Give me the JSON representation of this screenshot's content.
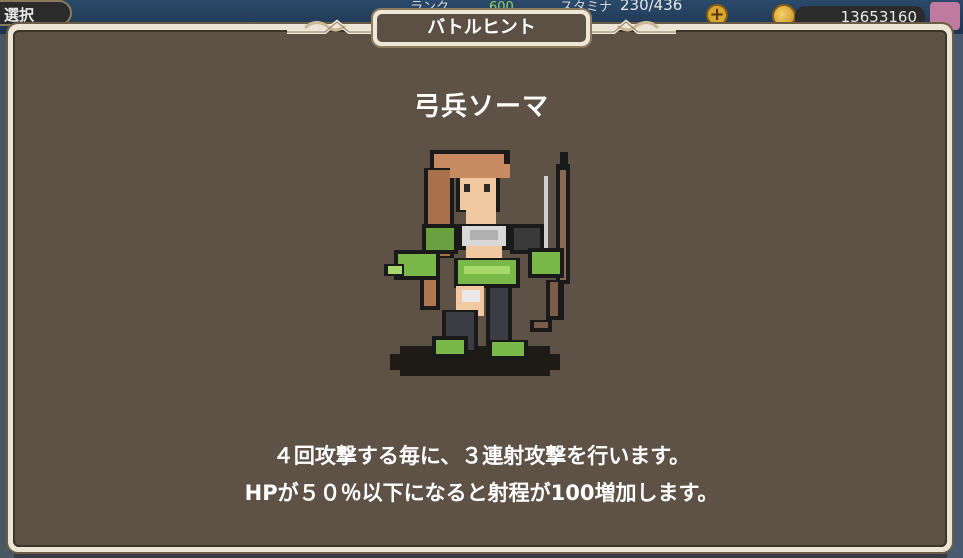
{
  "hud": {
    "mode_label": "選択",
    "rank_label": "ランク",
    "rank_value": "600",
    "stamina_label": "スタミナ",
    "stamina_value": "230/436",
    "plus_symbol": "+",
    "coins": "13653160"
  },
  "dialog": {
    "title": "バトルヒント",
    "unit_name": "弓兵ソーマ",
    "description_line1": "４回攻撃する毎に、３連射攻撃を行います。",
    "description_line2": "HPが５０％以下になると射程が100増加します。"
  },
  "icons": {
    "coin": "coin-icon",
    "add": "plus-icon",
    "sprite": "archer-sprite"
  },
  "colors": {
    "panel_bg": "#5e5246",
    "frame": "#ece4d4",
    "text": "#ffffff",
    "accent_green": "#8fd06a"
  }
}
